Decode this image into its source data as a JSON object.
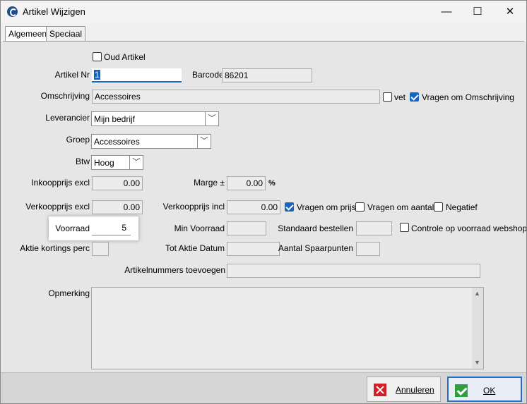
{
  "window": {
    "title": "Artikel Wijzigen",
    "minimize_icon": "—",
    "maximize_icon": "☐",
    "close_icon": "✕"
  },
  "tabs": [
    {
      "label": "Algemeen",
      "active": true
    },
    {
      "label": "Speciaal",
      "active": false
    }
  ],
  "form": {
    "oud_artikel": {
      "label": "Oud Artikel",
      "checked": false
    },
    "artikel_nr": {
      "label": "Artikel Nr",
      "value": "1"
    },
    "barcode": {
      "label": "Barcode",
      "value": "86201"
    },
    "omschrijving": {
      "label": "Omschrijving",
      "value": "Accessoires"
    },
    "vet": {
      "label": "vet",
      "checked": false
    },
    "vragen_om_omschrijving": {
      "label": "Vragen om Omschrijving",
      "checked": true
    },
    "leverancier": {
      "label": "Leverancier",
      "value": "Mijn bedrijf"
    },
    "groep": {
      "label": "Groep",
      "value": "Accessoires"
    },
    "btw": {
      "label": "Btw",
      "value": "Hoog"
    },
    "inkoopprijs_excl": {
      "label": "Inkoopprijs excl",
      "value": "0.00"
    },
    "marge": {
      "label": "Marge ±",
      "value": "0.00",
      "unit": "%"
    },
    "verkoopprijs_excl": {
      "label": "Verkoopprijs excl",
      "value": "0.00"
    },
    "verkoopprijs_incl": {
      "label": "Verkoopprijs incl",
      "value": "0.00"
    },
    "vragen_om_prijs": {
      "label": "Vragen om prijs",
      "checked": true
    },
    "vragen_om_aantal": {
      "label": "Vragen om aantal",
      "checked": false
    },
    "negatief": {
      "label": "Negatief",
      "checked": false
    },
    "voorraad": {
      "label": "Voorraad",
      "value": "5"
    },
    "min_voorraad": {
      "label": "Min Voorraad",
      "value": ""
    },
    "standaard_bestellen": {
      "label": "Standaard bestellen",
      "value": ""
    },
    "controle_op_voorraad_webshop": {
      "label": "Controle op voorraad webshop",
      "checked": false
    },
    "aktie_kortings_perc": {
      "label": "Aktie kortings perc",
      "value": ""
    },
    "tot_aktie_datum": {
      "label": "Tot Aktie Datum",
      "value": ""
    },
    "aantal_spaarpunten": {
      "label": "Aantal Spaarpunten",
      "value": ""
    },
    "artikelnummers_toevoegen": {
      "label": "Artikelnummers toevoegen",
      "value": ""
    },
    "opmerking": {
      "label": "Opmerking",
      "value": ""
    }
  },
  "buttons": {
    "annuleren": "Annuleren",
    "ok": "OK"
  },
  "colors": {
    "accent": "#1565c0",
    "cancel_icon": "#d0202a",
    "ok_icon": "#2e9e3e"
  }
}
